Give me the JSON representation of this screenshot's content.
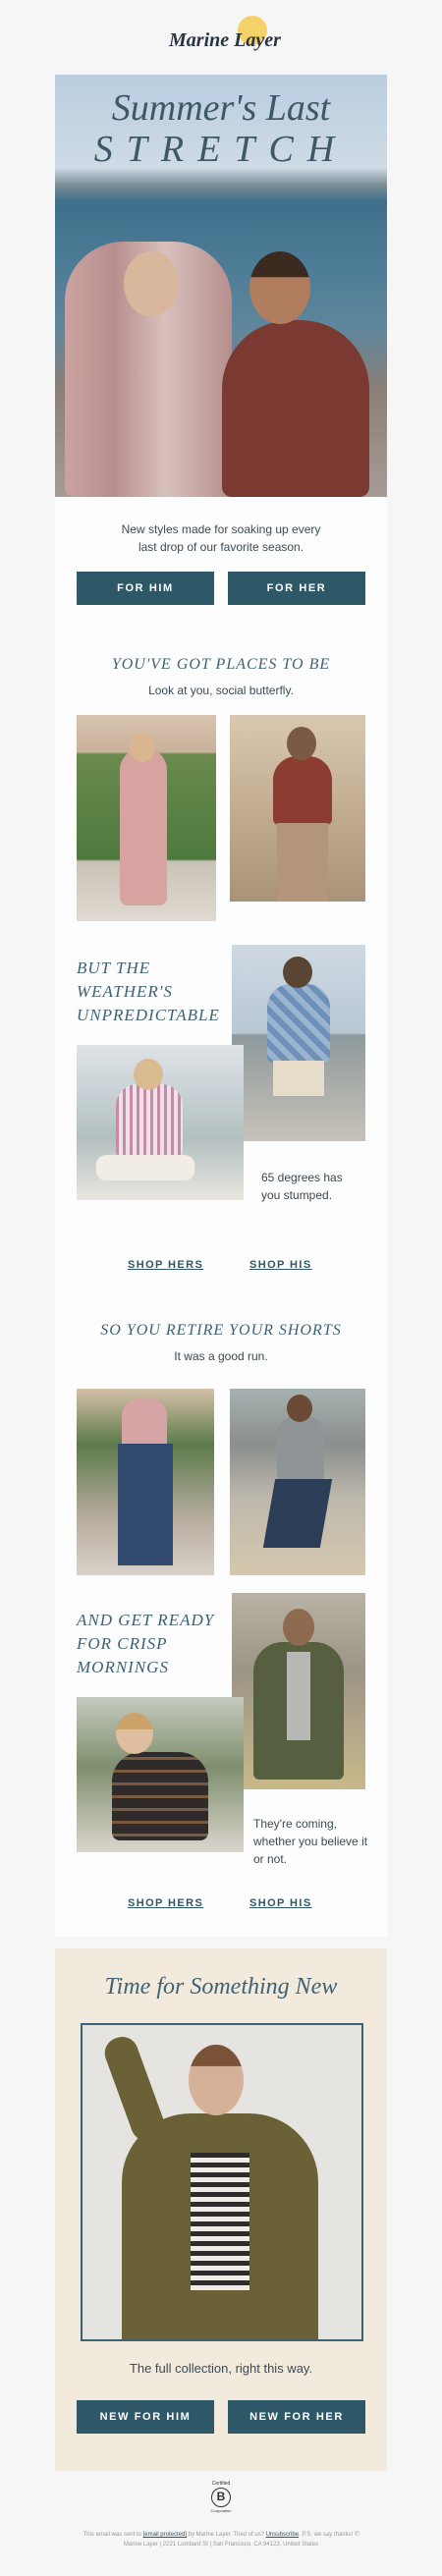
{
  "brand": {
    "logo_text": "Marine Layer",
    "sun_color": "#f5d16a"
  },
  "hero": {
    "title_line1": "Summer's Last",
    "title_line2": "STRETCH",
    "subtitle": "New styles made for soaking up every last drop of our favorite season.",
    "btn_him": "FOR HIM",
    "btn_her": "FOR HER"
  },
  "section1": {
    "heading": "YOU'VE GOT PLACES TO BE",
    "sub": "Look at you, social butterfly."
  },
  "section2": {
    "heading_lines": [
      "BUT THE",
      "WEATHER'S",
      "UNPREDICTABLE"
    ],
    "caption": "65 degrees has you stumped.",
    "shop_hers": "SHOP HERS",
    "shop_his": "SHOP HIS"
  },
  "section3": {
    "heading": "SO YOU RETIRE YOUR SHORTS",
    "sub": "It was a good run."
  },
  "section4": {
    "heading_lines": [
      "AND GET READY",
      "FOR CRISP",
      "MORNINGS"
    ],
    "caption": "They're coming, whether you believe it or not.",
    "shop_hers": "SHOP HERS",
    "shop_his": "SHOP HIS"
  },
  "promo": {
    "title": "Time for Something New",
    "sub": "The full collection, right this way.",
    "btn_him": "NEW FOR HIM",
    "btn_her": "NEW FOR HER"
  },
  "footer": {
    "badge_top": "Certified",
    "badge_letter": "B",
    "badge_bottom": "Corporation",
    "text_before": "This email was sent to",
    "email_link": "[email protected]",
    "text_mid": "by Marine Layer. Tired of us?",
    "unsub_link": "Unsubscribe",
    "text_after": ". P.S. we say thanks! © Marine Layer | 2221 Lombard St | San Francisco, CA 94123, United States"
  },
  "colors": {
    "accent": "#2e5867",
    "heading": "#3d6273",
    "promo_bg": "#f2ebdd"
  }
}
